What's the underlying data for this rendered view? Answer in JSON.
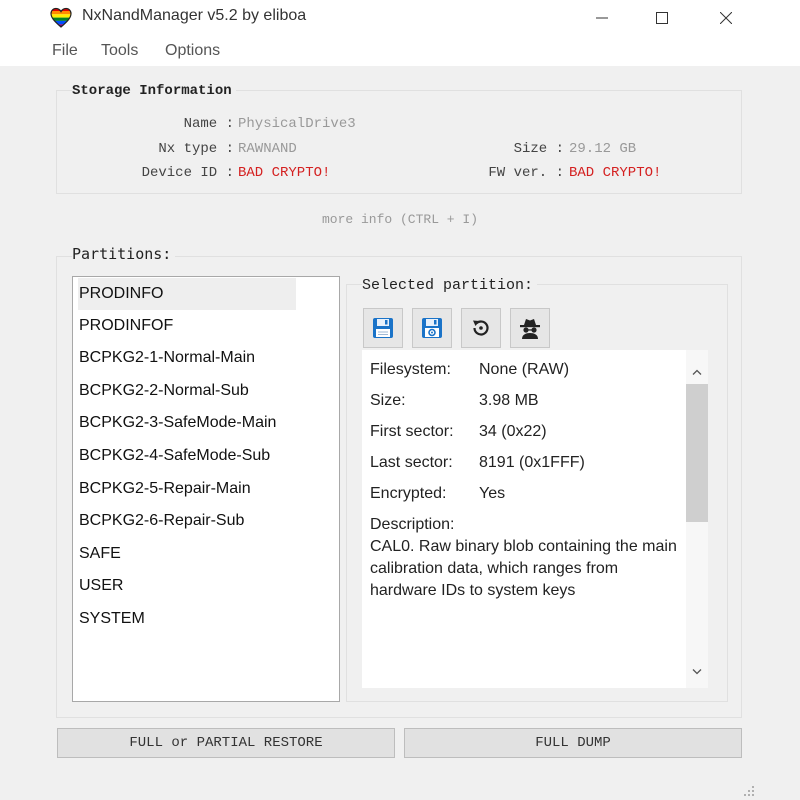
{
  "window": {
    "title": "NxNandManager v5.2 by eliboa"
  },
  "menu": {
    "file": "File",
    "tools": "Tools",
    "options": "Options"
  },
  "storage": {
    "title": "Storage Information",
    "name_label": "Name :",
    "name_value": "PhysicalDrive3",
    "type_label": "Nx type :",
    "type_value": "RAWNAND",
    "size_label": "Size :",
    "size_value": "29.12 GB",
    "device_id_label": "Device ID :",
    "device_id_value": "BAD CRYPTO!",
    "fw_label": "FW ver. :",
    "fw_value": "BAD CRYPTO!",
    "more_info": "more info (CTRL + I)"
  },
  "partitions": {
    "title": "Partitions:",
    "items": [
      "PRODINFO",
      "PRODINFOF",
      "BCPKG2-1-Normal-Main",
      "BCPKG2-2-Normal-Sub",
      "BCPKG2-3-SafeMode-Main",
      "BCPKG2-4-SafeMode-Sub",
      "BCPKG2-5-Repair-Main",
      "BCPKG2-6-Repair-Sub",
      "SAFE",
      "USER",
      "SYSTEM"
    ],
    "selected_index": 0
  },
  "selected": {
    "title": "Selected partition:",
    "toolbar_icons": [
      "save-icon",
      "save-settings-icon",
      "restore-icon",
      "spy-icon"
    ],
    "filesystem_label": "Filesystem:",
    "filesystem_value": "None (RAW)",
    "size_label": "Size:",
    "size_value": "3.98 MB",
    "first_sector_label": "First sector:",
    "first_sector_value": "34 (0x22)",
    "last_sector_label": "Last sector:",
    "last_sector_value": "8191 (0x1FFF)",
    "encrypted_label": "Encrypted:",
    "encrypted_value": "Yes",
    "description_label": "Description:",
    "description_value": "CAL0. Raw binary blob containing the main calibration data, which ranges from hardware IDs to system keys"
  },
  "buttons": {
    "restore": "FULL or PARTIAL RESTORE",
    "dump": "FULL DUMP"
  },
  "colors": {
    "error": "#d42020",
    "muted": "#999999",
    "accent": "#0a6cbd"
  }
}
